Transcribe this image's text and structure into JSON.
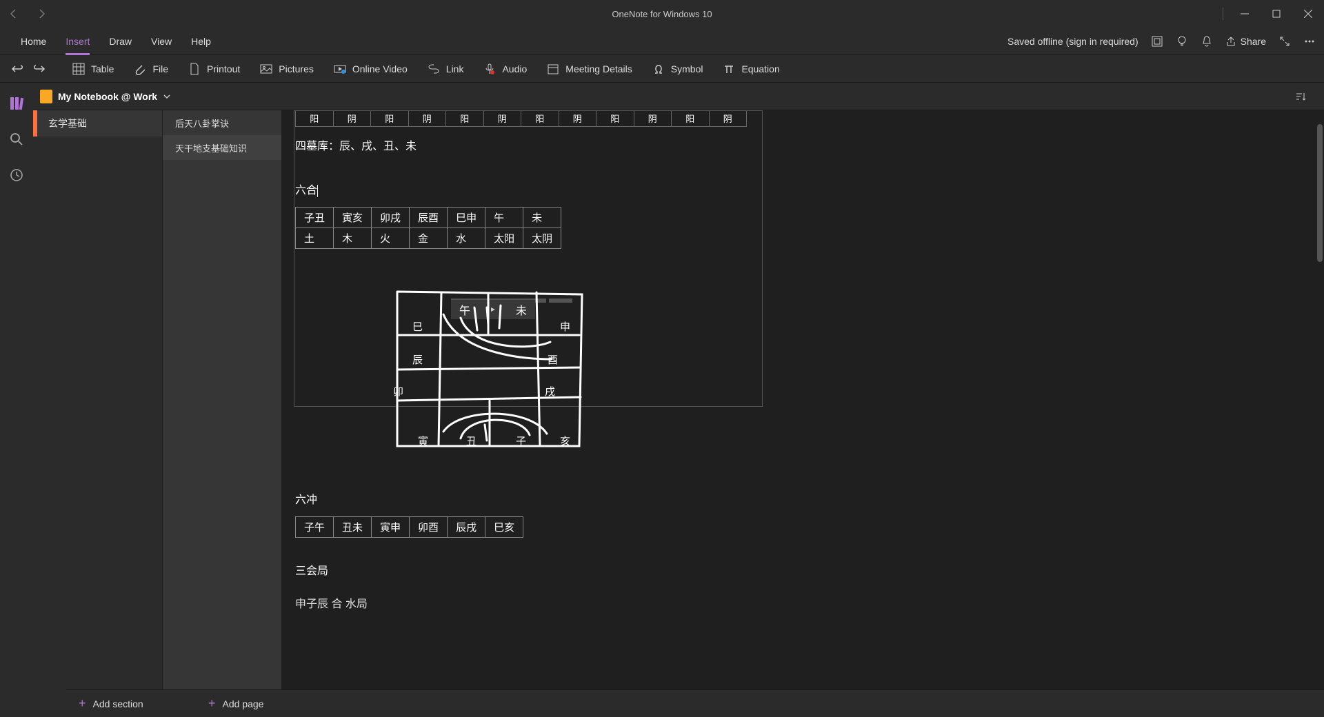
{
  "window": {
    "title": "OneNote for Windows 10"
  },
  "tabs": [
    "Home",
    "Insert",
    "Draw",
    "View",
    "Help"
  ],
  "active_tab": "Insert",
  "status": {
    "offline": "Saved offline (sign in required)",
    "share": "Share"
  },
  "ribbon": {
    "table": "Table",
    "file": "File",
    "printout": "Printout",
    "pictures": "Pictures",
    "video": "Online Video",
    "link": "Link",
    "audio": "Audio",
    "meeting": "Meeting Details",
    "symbol": "Symbol",
    "equation": "Equation"
  },
  "notebook": {
    "name": "My Notebook @ Work"
  },
  "sections": [
    {
      "label": "玄学基础",
      "active": true
    }
  ],
  "pages": [
    {
      "label": "后天八卦掌诀",
      "active": false
    },
    {
      "label": "天干地支基础知识",
      "active": true
    }
  ],
  "content": {
    "top_row": [
      "阳",
      "阴",
      "阳",
      "阴",
      "阳",
      "阴",
      "阳",
      "阴",
      "阳",
      "阴",
      "阳",
      "阴"
    ],
    "simuku": "四墓库：辰、戌、丑、未",
    "liuhe_title": "六合",
    "liuhe_table": [
      [
        "子丑",
        "寅亥",
        "卯戌",
        "辰酉",
        "巳申",
        "午",
        "未"
      ],
      [
        "土",
        "木",
        "火",
        "金",
        "水",
        "太阳",
        "太阴"
      ]
    ],
    "diagram_top": {
      "wu": "午",
      "wei": "未"
    },
    "diagram_left": [
      "巳",
      "辰",
      "卯",
      "寅"
    ],
    "diagram_right": [
      "申",
      "酉",
      "戌",
      "亥"
    ],
    "diagram_bottom": [
      "丑",
      "子"
    ],
    "liuchong_title": "六冲",
    "liuchong_table": [
      [
        "子午",
        "丑未",
        "寅申",
        "卯酉",
        "辰戌",
        "巳亥"
      ]
    ],
    "sanhui_title": "三会局",
    "sanhui_line": "申子辰 合 水局"
  },
  "footer": {
    "add_section": "Add section",
    "add_page": "Add page"
  }
}
